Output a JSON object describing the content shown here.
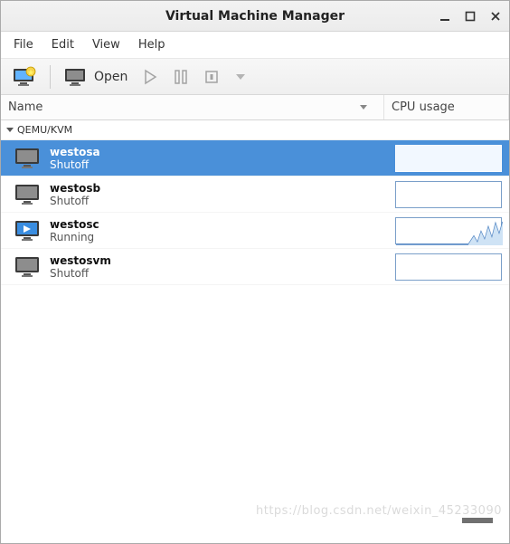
{
  "window": {
    "title": "Virtual Machine Manager"
  },
  "menubar": {
    "items": [
      {
        "label": "File"
      },
      {
        "label": "Edit"
      },
      {
        "label": "View"
      },
      {
        "label": "Help"
      }
    ]
  },
  "toolbar": {
    "new_vm_tooltip": "New VM",
    "console_tooltip": "Open console",
    "open_label": "Open",
    "run_tooltip": "Run",
    "pause_tooltip": "Pause",
    "shutdown_tooltip": "Shut Down"
  },
  "columns": {
    "name": "Name",
    "cpu": "CPU usage"
  },
  "connection": {
    "label": "QEMU/KVM"
  },
  "vms": [
    {
      "name": "westosa",
      "state": "Shutoff",
      "running": false,
      "selected": true
    },
    {
      "name": "westosb",
      "state": "Shutoff",
      "running": false,
      "selected": false
    },
    {
      "name": "westosc",
      "state": "Running",
      "running": true,
      "selected": false
    },
    {
      "name": "westosvm",
      "state": "Shutoff",
      "running": false,
      "selected": false
    }
  ],
  "watermark": "https://blog.csdn.net/weixin_45233090"
}
